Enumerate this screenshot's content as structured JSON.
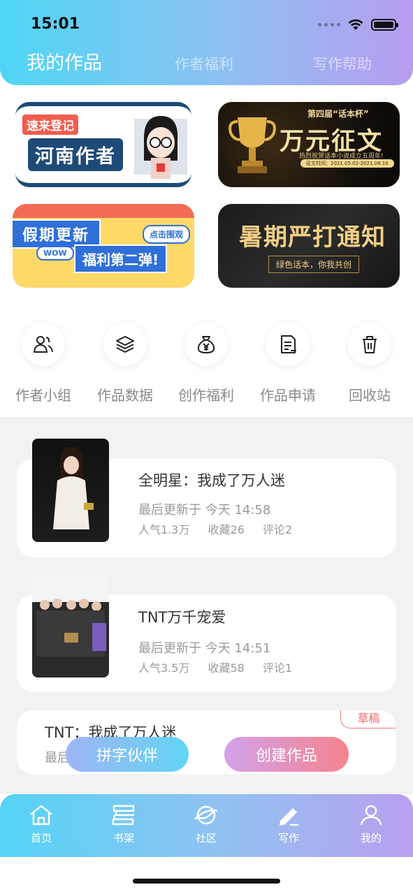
{
  "status_bar": {
    "time": "15:01"
  },
  "header_tabs": [
    {
      "label": "我的作品",
      "active": true
    },
    {
      "label": "作者福利",
      "active": false
    },
    {
      "label": "写作帮助",
      "active": false
    }
  ],
  "banners": {
    "henan": {
      "tag": "速来登记",
      "title": "河南作者"
    },
    "contest": {
      "small": "第四届“话本杯”",
      "title": "万元征文",
      "line": "热烈祝贺话本小说成立五周年!",
      "date": "征文时间：2021.05.02-2021.08.10"
    },
    "holiday": {
      "title": "假期更新",
      "bubble": "点击围观",
      "wow": "WOW",
      "subtitle": "福利第二弹!"
    },
    "summer": {
      "title": "暑期严打通知",
      "subtitle": "绿色话本，你我共创"
    }
  },
  "quick_actions": [
    {
      "label": "作者小组",
      "icon": "users-icon"
    },
    {
      "label": "作品数据",
      "icon": "layers-icon"
    },
    {
      "label": "创作福利",
      "icon": "money-bag-icon"
    },
    {
      "label": "作品申请",
      "icon": "document-icon"
    },
    {
      "label": "回收站",
      "icon": "trash-icon"
    }
  ],
  "works": [
    {
      "title": "全明星：我成了万人迷",
      "updated": "最后更新于 今天 14:58",
      "popularity": "人气1.3万",
      "favorites": "收藏26",
      "comments": "评论2"
    },
    {
      "title": "TNT万千宠爱",
      "updated": "最后更新于 今天 14:51",
      "popularity": "人气3.5万",
      "favorites": "收藏58",
      "comments": "评论1"
    },
    {
      "title": "TNT：我成了万人迷",
      "updated_partial": "最后",
      "badge": "草稿"
    }
  ],
  "floating_buttons": {
    "partner": "拼字伙伴",
    "create": "创建作品"
  },
  "bottom_nav": [
    {
      "label": "首页",
      "icon": "home-icon"
    },
    {
      "label": "书架",
      "icon": "bookshelf-icon"
    },
    {
      "label": "社区",
      "icon": "planet-icon"
    },
    {
      "label": "写作",
      "icon": "pen-icon",
      "active": true
    },
    {
      "label": "我的",
      "icon": "user-icon"
    }
  ],
  "colors": {
    "header_start": "#4fd6f5",
    "header_end": "#b79cf0",
    "draft": "#f06b6b"
  }
}
